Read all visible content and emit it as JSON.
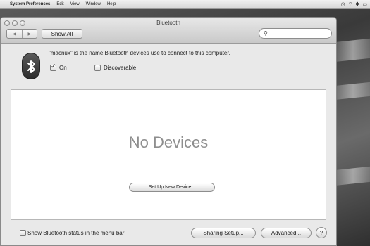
{
  "menubar": {
    "apple_glyph": "",
    "items": [
      "System Preferences",
      "Edit",
      "View",
      "Window",
      "Help"
    ],
    "status_icons": [
      "time-machine-icon",
      "wifi-icon",
      "bluetooth-icon",
      "battery-icon"
    ]
  },
  "window": {
    "title": "Bluetooth",
    "show_all_label": "Show All",
    "nav_back": "◀",
    "nav_forward": "▶",
    "search_placeholder": ""
  },
  "bluetooth": {
    "name_message": "\"macnux\" is the name Bluetooth devices use to connect to this computer.",
    "on_label": "On",
    "on_checked": true,
    "discoverable_label": "Discoverable",
    "discoverable_checked": false
  },
  "devices": {
    "empty_message": "No Devices",
    "setup_button": "Set Up New Device..."
  },
  "footer": {
    "show_status_label": "Show Bluetooth status in the menu bar",
    "show_status_checked": false,
    "sharing_button": "Sharing Setup...",
    "advanced_button": "Advanced...",
    "help_label": "?"
  }
}
